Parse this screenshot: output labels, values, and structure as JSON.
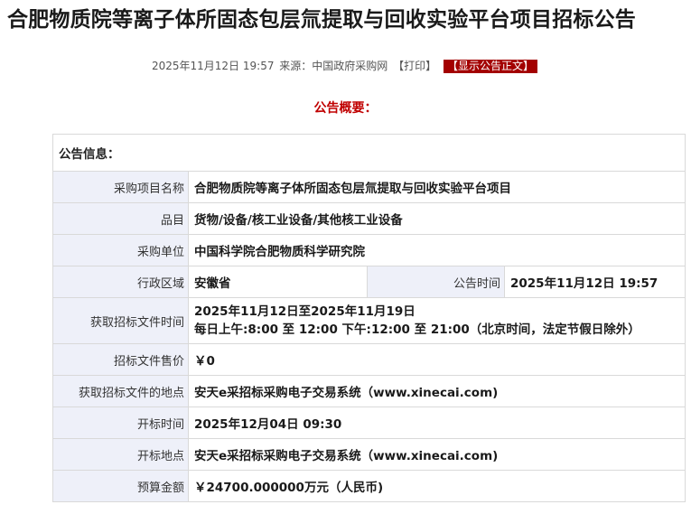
{
  "title": "合肥物质院等离子体所固态包层氚提取与回收实验平台项目招标公告",
  "meta": {
    "datetime": "2025年11月12日 19:57",
    "source": "来源：中国政府采购网",
    "print": "【打印】",
    "show_text": "【显示公告正文】"
  },
  "summary_heading": "公告概要：",
  "info": {
    "heading": "公告信息：",
    "rows": {
      "project_name": {
        "label": "采购项目名称",
        "value": "合肥物质院等离子体所固态包层氚提取与回收实验平台项目"
      },
      "category": {
        "label": "品目",
        "value": "货物/设备/核工业设备/其他核工业设备"
      },
      "buyer": {
        "label": "采购单位",
        "value": "中国科学院合肥物质科学研究院"
      },
      "region": {
        "label": "行政区域",
        "value": "安徽省"
      },
      "publish_time": {
        "label": "公告时间",
        "value": "2025年11月12日 19:57"
      },
      "doc_time": {
        "label": "获取招标文件时间",
        "value_line1": "2025年11月12日至2025年11月19日",
        "value_line2": "每日上午:8:00 至 12:00  下午:12:00 至 21:00（北京时间，法定节假日除外）"
      },
      "doc_price": {
        "label": "招标文件售价",
        "value": "￥0"
      },
      "doc_location": {
        "label": "获取招标文件的地点",
        "value": "安天e采招标采购电子交易系统（www.xinecai.com)"
      },
      "open_time": {
        "label": "开标时间",
        "value": "2025年12月04日 09:30"
      },
      "open_location": {
        "label": "开标地点",
        "value": "安天e采招标采购电子交易系统（www.xinecai.com)"
      },
      "budget": {
        "label": "预算金额",
        "value": "￥24700.000000万元（人民币)"
      }
    }
  }
}
